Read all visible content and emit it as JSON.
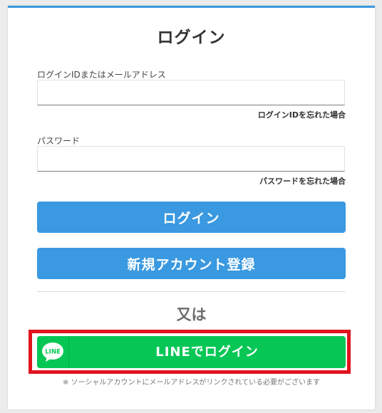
{
  "page": {
    "title": "ログイン"
  },
  "login_form": {
    "id_label": "ログインIDまたはメールアドレス",
    "id_value": "",
    "id_placeholder": "",
    "forgot_id_link": "ログインIDを忘れた場合",
    "password_label": "パスワード",
    "password_value": "",
    "password_placeholder": "",
    "forgot_password_link": "パスワードを忘れた場合",
    "login_button": "ログイン",
    "register_button": "新規アカウント登録"
  },
  "separator_text": "又は",
  "line_login": {
    "icon_text": "LINE",
    "button_label": "LINEでログイン",
    "note": "※ ソーシャルアカウントにメールアドレスがリンクされている必要がございます"
  },
  "colors": {
    "accent": "#3a99e0",
    "line_green": "#06c755",
    "highlight_red": "#e0141e"
  }
}
